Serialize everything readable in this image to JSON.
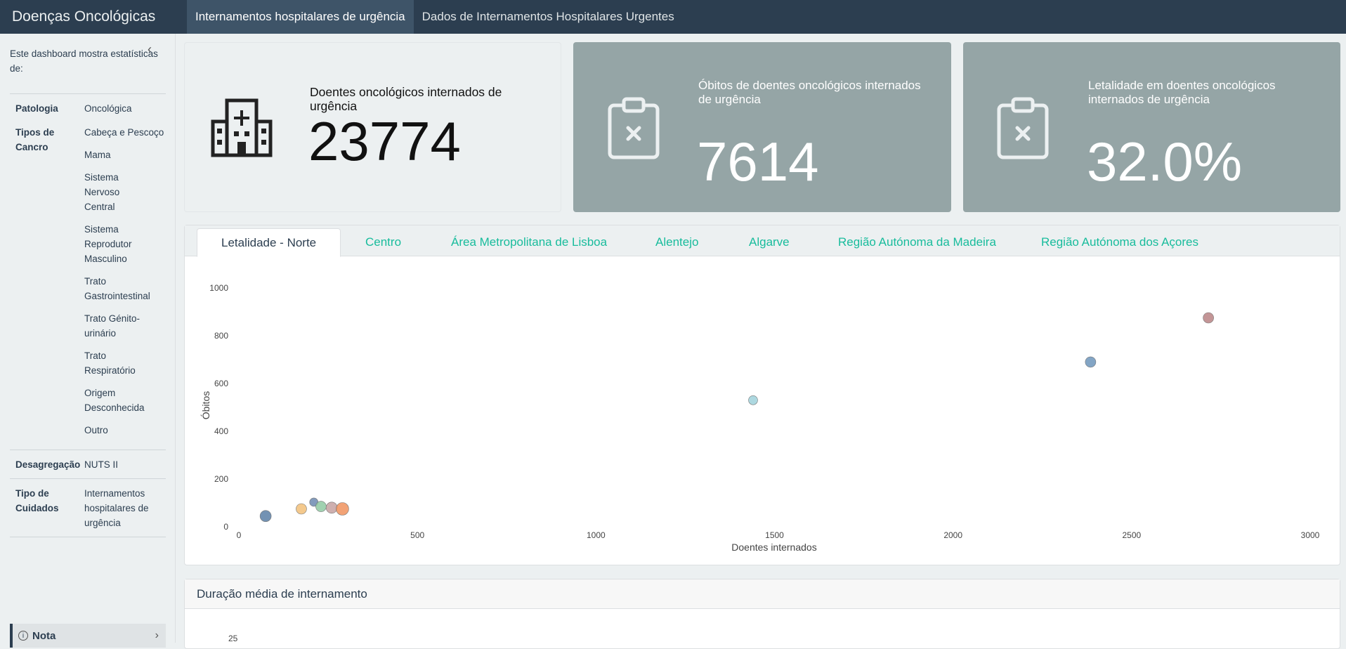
{
  "app": {
    "brand": "Doenças Oncológicas"
  },
  "nav": {
    "tabs": [
      {
        "label": "Internamentos hospitalares de urgência",
        "active": true
      },
      {
        "label": "Dados de Internamentos Hospitalares Urgentes",
        "active": false
      }
    ]
  },
  "sidebar": {
    "intro": "Este dashboard mostra estatísticas de:",
    "meta": [
      {
        "key": "Patologia",
        "values": [
          "Oncológica"
        ]
      },
      {
        "key": "Tipos de Cancro",
        "values": [
          "Cabeça e Pescoço",
          "Mama",
          "Sistema Nervoso Central",
          "Sistema Reprodutor Masculino",
          "Trato Gastrointestinal",
          "Trato Génito-urinário",
          "Trato Respiratório",
          "Origem Desconhecida",
          "Outro"
        ]
      },
      {
        "key": "Desagregação",
        "values": [
          "NUTS II"
        ]
      },
      {
        "key": "Tipo de Cuidados",
        "values": [
          "Internamentos hospitalares de urgência"
        ]
      }
    ],
    "nota": {
      "label": "Nota"
    }
  },
  "cards": [
    {
      "title": "Doentes oncológicos internados de urgência",
      "value": "23774",
      "icon": "hospital-icon"
    },
    {
      "title": "Óbitos de doentes oncológicos internados de urgência",
      "value": "7614",
      "icon": "clipboard-x-icon"
    },
    {
      "title": "Letalidade em doentes oncológicos internados de urgência",
      "value": "32.0%",
      "icon": "clipboard-x-icon"
    }
  ],
  "region_tabs": [
    {
      "label": "Letalidade - Norte",
      "active": true
    },
    {
      "label": "Centro",
      "active": false
    },
    {
      "label": "Área Metropolitana de Lisboa",
      "active": false
    },
    {
      "label": "Alentejo",
      "active": false
    },
    {
      "label": "Algarve",
      "active": false
    },
    {
      "label": "Região Autónoma da Madeira",
      "active": false
    },
    {
      "label": "Região Autónoma dos Açores",
      "active": false
    }
  ],
  "chart_data": {
    "type": "scatter",
    "title": "",
    "xlabel": "Doentes internados",
    "ylabel": "Óbitos",
    "xlim": [
      0,
      3000
    ],
    "ylim": [
      0,
      1000
    ],
    "xticks": [
      "0",
      "500",
      "1000",
      "1500",
      "2000",
      "2500",
      "3000"
    ],
    "yticks": [
      "0",
      "200",
      "400",
      "600",
      "800",
      "1000"
    ],
    "grid": false,
    "points": [
      {
        "x": 75,
        "y": 45,
        "size": 14,
        "color": "#5b7fa6"
      },
      {
        "x": 175,
        "y": 75,
        "size": 13,
        "color": "#f2c079"
      },
      {
        "x": 210,
        "y": 103,
        "size": 10,
        "color": "#6c8ab0"
      },
      {
        "x": 230,
        "y": 85,
        "size": 13,
        "color": "#8fc9a2"
      },
      {
        "x": 260,
        "y": 80,
        "size": 14,
        "color": "#c6a1a1"
      },
      {
        "x": 290,
        "y": 75,
        "size": 16,
        "color": "#f0925d"
      },
      {
        "x": 1440,
        "y": 530,
        "size": 11,
        "color": "#9fd1db"
      },
      {
        "x": 2385,
        "y": 690,
        "size": 13,
        "color": "#6d95bb"
      },
      {
        "x": 2715,
        "y": 875,
        "size": 13,
        "color": "#b98284"
      }
    ]
  },
  "panel2": {
    "title": "Duração média de internamento",
    "first_tick": "25"
  }
}
